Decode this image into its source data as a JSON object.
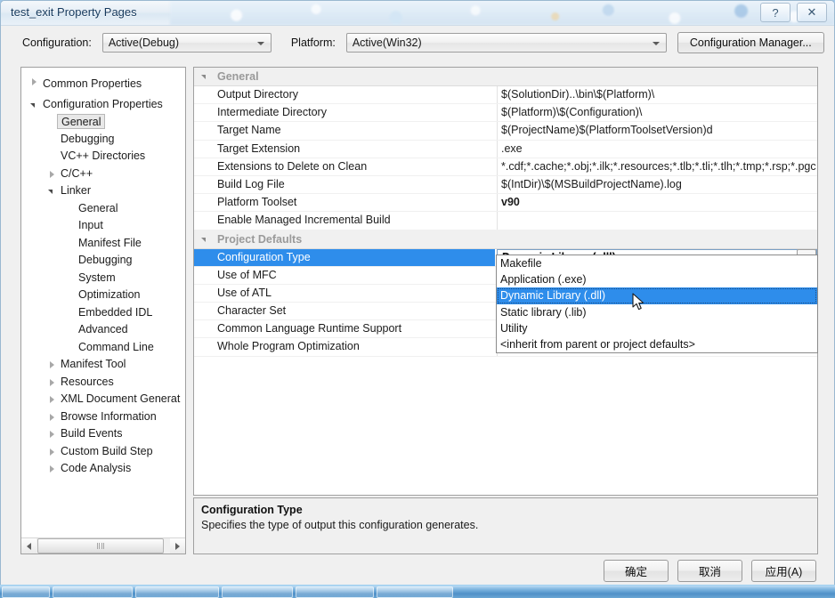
{
  "window": {
    "title": "test_exit Property Pages",
    "help_button": "?",
    "close_button": "✕"
  },
  "toolbar": {
    "configuration_label": "Configuration:",
    "configuration_value": "Active(Debug)",
    "platform_label": "Platform:",
    "platform_value": "Active(Win32)",
    "configuration_manager_label": "Configuration Manager..."
  },
  "tree": {
    "items": [
      {
        "label": "Common Properties",
        "indent": 0,
        "twisty": "collapsed",
        "selected": false
      },
      {
        "label": "Configuration Properties",
        "indent": 0,
        "twisty": "expanded",
        "selected": false
      },
      {
        "label": "General",
        "indent": 1,
        "twisty": "none",
        "selected": true
      },
      {
        "label": "Debugging",
        "indent": 1,
        "twisty": "none",
        "selected": false
      },
      {
        "label": "VC++ Directories",
        "indent": 1,
        "twisty": "none",
        "selected": false
      },
      {
        "label": "C/C++",
        "indent": 1,
        "twisty": "collapsed",
        "selected": false
      },
      {
        "label": "Linker",
        "indent": 1,
        "twisty": "expanded",
        "selected": false
      },
      {
        "label": "General",
        "indent": 2,
        "twisty": "none",
        "selected": false
      },
      {
        "label": "Input",
        "indent": 2,
        "twisty": "none",
        "selected": false
      },
      {
        "label": "Manifest File",
        "indent": 2,
        "twisty": "none",
        "selected": false
      },
      {
        "label": "Debugging",
        "indent": 2,
        "twisty": "none",
        "selected": false
      },
      {
        "label": "System",
        "indent": 2,
        "twisty": "none",
        "selected": false
      },
      {
        "label": "Optimization",
        "indent": 2,
        "twisty": "none",
        "selected": false
      },
      {
        "label": "Embedded IDL",
        "indent": 2,
        "twisty": "none",
        "selected": false
      },
      {
        "label": "Advanced",
        "indent": 2,
        "twisty": "none",
        "selected": false
      },
      {
        "label": "Command Line",
        "indent": 2,
        "twisty": "none",
        "selected": false
      },
      {
        "label": "Manifest Tool",
        "indent": 1,
        "twisty": "collapsed",
        "selected": false
      },
      {
        "label": "Resources",
        "indent": 1,
        "twisty": "collapsed",
        "selected": false
      },
      {
        "label": "XML Document Generat",
        "indent": 1,
        "twisty": "collapsed",
        "selected": false
      },
      {
        "label": "Browse Information",
        "indent": 1,
        "twisty": "collapsed",
        "selected": false
      },
      {
        "label": "Build Events",
        "indent": 1,
        "twisty": "collapsed",
        "selected": false
      },
      {
        "label": "Custom Build Step",
        "indent": 1,
        "twisty": "collapsed",
        "selected": false
      },
      {
        "label": "Code Analysis",
        "indent": 1,
        "twisty": "collapsed",
        "selected": false
      }
    ]
  },
  "grid": {
    "sections": [
      {
        "header": "General",
        "rows": [
          {
            "name": "Output Directory",
            "value": "$(SolutionDir)..\\bin\\$(Platform)\\",
            "bold": false,
            "selected": false
          },
          {
            "name": "Intermediate Directory",
            "value": "$(Platform)\\$(Configuration)\\",
            "bold": false,
            "selected": false
          },
          {
            "name": "Target Name",
            "value": "$(ProjectName)$(PlatformToolsetVersion)d",
            "bold": false,
            "selected": false
          },
          {
            "name": "Target Extension",
            "value": ".exe",
            "bold": false,
            "selected": false
          },
          {
            "name": "Extensions to Delete on Clean",
            "value": "*.cdf;*.cache;*.obj;*.ilk;*.resources;*.tlb;*.tli;*.tlh;*.tmp;*.rsp;*.pgc",
            "bold": false,
            "selected": false
          },
          {
            "name": "Build Log File",
            "value": "$(IntDir)\\$(MSBuildProjectName).log",
            "bold": false,
            "selected": false
          },
          {
            "name": "Platform Toolset",
            "value": "v90",
            "bold": true,
            "selected": false
          },
          {
            "name": "Enable Managed Incremental Build",
            "value": "",
            "bold": false,
            "selected": false
          }
        ]
      },
      {
        "header": "Project Defaults",
        "rows": [
          {
            "name": "Configuration Type",
            "value": "Dynamic Library (.dll)",
            "bold": true,
            "selected": true,
            "editing": true
          },
          {
            "name": "Use of MFC",
            "value": "",
            "bold": false,
            "selected": false
          },
          {
            "name": "Use of ATL",
            "value": "",
            "bold": false,
            "selected": false
          },
          {
            "name": "Character Set",
            "value": "",
            "bold": false,
            "selected": false
          },
          {
            "name": "Common Language Runtime Support",
            "value": "",
            "bold": false,
            "selected": false
          },
          {
            "name": "Whole Program Optimization",
            "value": "",
            "bold": false,
            "selected": false
          }
        ]
      }
    ]
  },
  "dropdown": {
    "open": true,
    "selected_value": "Dynamic Library (.dll)",
    "options": [
      "Makefile",
      "Application (.exe)",
      "Dynamic Library (.dll)",
      "Static library (.lib)",
      "Utility",
      "<inherit from parent or project defaults>"
    ]
  },
  "description": {
    "title": "Configuration Type",
    "body": "Specifies the type of output this configuration generates."
  },
  "footer": {
    "ok_label": "确定",
    "cancel_label": "取消",
    "apply_label": "应用(A)"
  },
  "colors": {
    "selection_blue": "#2e8deb",
    "header_gray": "#f0f0f0",
    "dialog_face": "#f0f0f0"
  }
}
